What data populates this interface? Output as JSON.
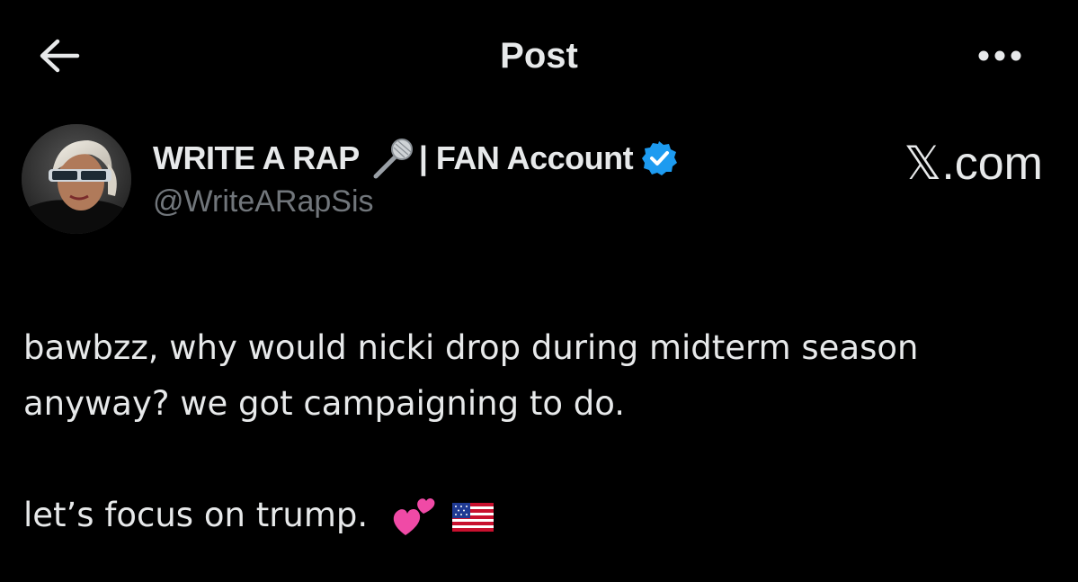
{
  "header": {
    "title": "Post",
    "back_icon": "arrow-left-icon",
    "more_icon": "more-horizontal-icon"
  },
  "author": {
    "display_name": "WRITE A RAP",
    "display_name_suffix": "| FAN Account",
    "name_emoji": "microphone-icon",
    "verified": true,
    "verified_color": "#1d9bf0",
    "handle": "@WriteARapSis"
  },
  "source_brand": "𝕏.com",
  "post": {
    "line1": "bawbzz, why would nicki drop during midterm season",
    "line2": "anyway? we got campaigning to do.",
    "line3": "let’s focus on trump.",
    "trailing_emojis": [
      "two-hearts-icon",
      "us-flag-icon"
    ]
  },
  "colors": {
    "background": "#000000",
    "text": "#e7e9ea",
    "secondary_text": "#71767b",
    "accent": "#1d9bf0"
  }
}
